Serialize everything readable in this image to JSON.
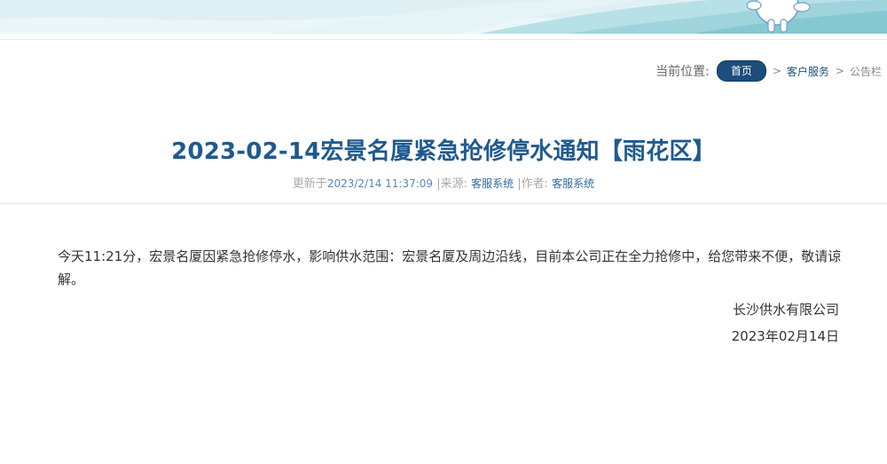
{
  "breadcrumb": {
    "label": "当前位置:",
    "home": "首页",
    "sep": ">",
    "section": "客户服务",
    "current": "公告栏"
  },
  "article": {
    "title": "2023-02-14宏景名厦紧急抢修停水通知【雨花区】",
    "meta": {
      "updated_label": "更新于",
      "updated_value": "2023/2/14 11:37:09",
      "source_label": "|来源:",
      "source_value": "客服系统",
      "author_label": "|作者:",
      "author_value": "客服系统"
    },
    "body": "今天11:21分，宏景名厦因紧急抢修停水，影响供水范围：宏景名厦及周边沿线，目前本公司正在全力抢修中，给您带来不便，敬请谅解。",
    "signature": {
      "company": "长沙供水有限公司",
      "date": "2023年02月14日"
    }
  },
  "colors": {
    "title": "#1f5a8e",
    "home_pill": "#1b4e7a",
    "meta_value": "#5b88b8",
    "banner_light": "#dceef3",
    "banner_mid": "#a9d9e0"
  },
  "icons": {
    "banner_mascot": "water-drop-mascot"
  }
}
